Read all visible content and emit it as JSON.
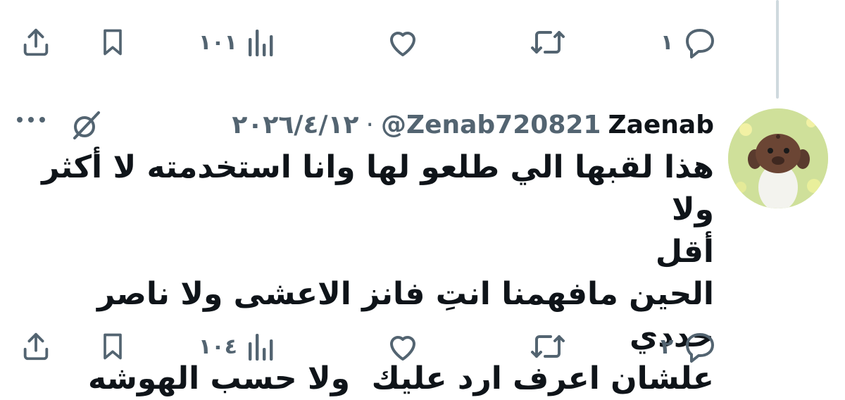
{
  "top_actions": {
    "reply_count": "١",
    "views_count": "١٠١"
  },
  "tweet": {
    "display_name": "Zaenab",
    "handle": "@Zenab720821",
    "separator": "·",
    "date": "٢٠٢٦/٤/١٢",
    "text_lines": [
      "هذا لقبها الي طلعو لها وانا استخدمته لا أكثر ولا",
      "أقل",
      "الحين مافهمنا انتِ فانز الاعشى ولا ناصر حددي",
      "علشان اعرف ارد عليك  ولا حسب الهوشه"
    ]
  },
  "bottom_actions": {
    "reply_count": "٢",
    "views_count": "١٠٤"
  },
  "icons": {
    "reply": "reply-icon",
    "retweet": "retweet-icon",
    "like": "heart-icon",
    "views": "views-bar-chart-icon",
    "bookmark": "bookmark-icon",
    "share": "share-icon",
    "more": "more-dots-icon",
    "grok": "grok-icon"
  },
  "colors": {
    "icon_gray": "#536471",
    "text": "#0f1419",
    "thread_line": "#cfd9de"
  }
}
